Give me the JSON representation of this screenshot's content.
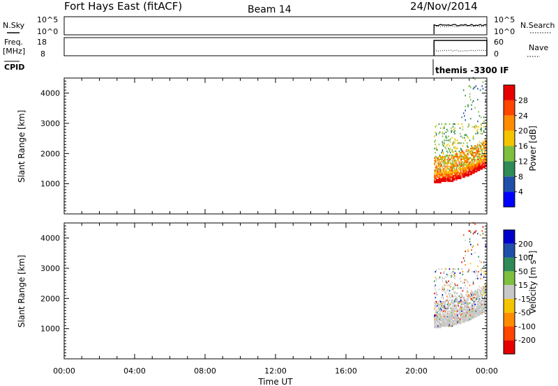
{
  "header": {
    "title": "Fort Hays East (fitACF)",
    "beam": "Beam 14",
    "date": "24/Nov/2014"
  },
  "noise_panel": {
    "left_label": "N.Sky",
    "left_ticks": [
      "10^5",
      "10^0"
    ],
    "right_ticks": [
      "10^5",
      "10^0"
    ],
    "right_label": "N.Search"
  },
  "freq_panel": {
    "left_label_line1": "Freq.",
    "left_label_line2": "[MHz]",
    "left_ticks": [
      "18",
      "8"
    ],
    "right_ticks": [
      "60",
      "0"
    ],
    "right_label": "Nave"
  },
  "cpid": {
    "label": "CPID",
    "program": "themis -3300 IF"
  },
  "colors": {
    "power_scale": [
      "#0000ff",
      "#1f4fa8",
      "#2e8b57",
      "#7fbf3f",
      "#f5c400",
      "#ff8c00",
      "#ff4500",
      "#e60000"
    ],
    "velocity_scale": [
      "#e60000",
      "#ff4500",
      "#ff8c00",
      "#f5c400",
      "#c8c8c8",
      "#7fbf3f",
      "#2e8b57",
      "#1f4fa8",
      "#0000cc"
    ],
    "ground_scatter": "#c8c8c8"
  },
  "chart_data": [
    {
      "type": "heatmap",
      "name": "power",
      "ylabel": "Slant Range [km]",
      "ylim": [
        0,
        4500
      ],
      "yticks": [
        "1000",
        "2000",
        "3000",
        "4000"
      ],
      "xlim_hours": [
        0,
        24
      ],
      "colorbar_label": "Power [dB]",
      "colorbar_ticks": [
        "4",
        "8",
        "12",
        "16",
        "20",
        "24",
        "28"
      ],
      "colorbar_range": [
        0,
        32
      ],
      "data_start_hours": 21.0,
      "lower_edge_km": [
        [
          21.0,
          1100
        ],
        [
          22.0,
          1150
        ],
        [
          23.0,
          1350
        ],
        [
          24.0,
          1650
        ]
      ],
      "note_region": "most echoes between 21:00 and 24:00 UT, 1000-2500 km, sparse echoes up to 4500 km"
    },
    {
      "type": "heatmap",
      "name": "velocity",
      "ylabel": "Slant Range [km]",
      "ylim": [
        0,
        4500
      ],
      "yticks": [
        "1000",
        "2000",
        "3000",
        "4000"
      ],
      "xlim_hours": [
        0,
        24
      ],
      "colorbar_label": "Velocity [m s^-1]",
      "colorbar_ticks": [
        "200",
        "100",
        "50",
        "15",
        "-15",
        "-50",
        "-100",
        "-200"
      ],
      "data_start_hours": 21.0
    }
  ],
  "x_axis": {
    "ticks": [
      "00:00",
      "04:00",
      "08:00",
      "12:00",
      "16:00",
      "20:00",
      "00:00"
    ],
    "label": "Time UT"
  }
}
